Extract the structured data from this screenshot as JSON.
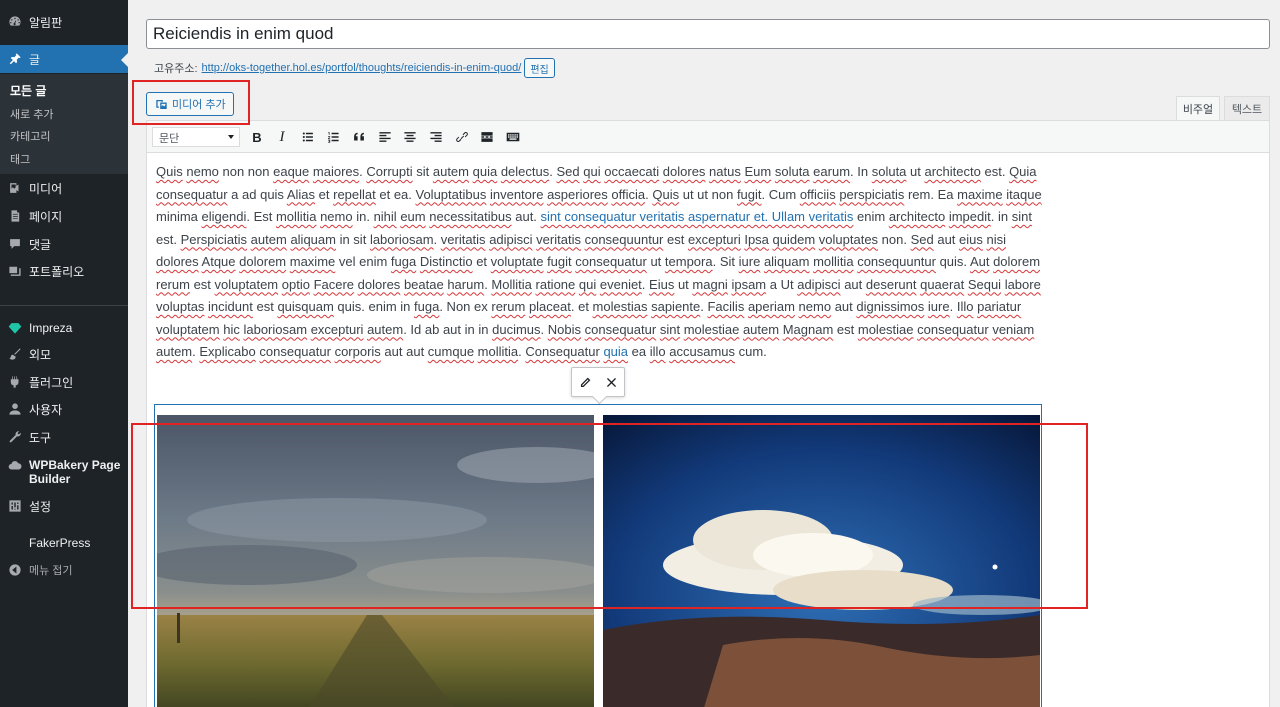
{
  "sidebar": {
    "dashboard": "알림판",
    "posts": "글",
    "submenu": [
      "모든 글",
      "새로 추가",
      "카테고리",
      "태그"
    ],
    "media": "미디어",
    "pages": "페이지",
    "comments": "댓글",
    "portfolio": "포트폴리오",
    "impreza": "Impreza",
    "appearance": "외모",
    "plugins": "플러그인",
    "users": "사용자",
    "tools": "도구",
    "wpbakery_line1": "WPBakery Page",
    "wpbakery_line2": "Builder",
    "settings": "설정",
    "fakerpress": "FakerPress",
    "collapse": "메뉴 접기",
    "accent_color": "#2271b1"
  },
  "post": {
    "title": "Reiciendis in enim quod",
    "permalink_label": "고유주소:",
    "permalink_url": "http://oks-together.hol.es/portfol/thoughts/reiciendis-in-enim-quod/",
    "permalink_edit": "편집"
  },
  "editor": {
    "add_media": "미디어 추가",
    "tab_visual": "비주얼",
    "tab_text": "텍스트",
    "format_select": "문단",
    "toolbar_icons": [
      "bold-icon",
      "italic-icon",
      "bullet-list-icon",
      "numbered-list-icon",
      "blockquote-icon",
      "align-left-icon",
      "align-center-icon",
      "align-right-icon",
      "link-icon",
      "read-more-icon",
      "toolbar-toggle-icon"
    ]
  },
  "content": {
    "paragraph": "Quis nemo non non eaque maiores. Corrupti sit autem quia delectus. Sed qui occaecati dolores natus Eum soluta earum. In soluta ut architecto est. Quia consequatur a ad quis Alias et repellat et ea. Voluptatibus inventore asperiores officia. Quis ut ut non fugit. Cum officiis perspiciatis rem. Ea maxime itaque minima eligendi. Est mollitia nemo in. nihil eum necessitatibus aut. sint consequatur veritatis aspernatur et. Ullam veritatis enim architecto impedit. in sint est. Perspiciatis autem aliquam in sit laboriosam. veritatis adipisci veritatis consequuntur est excepturi Ipsa quidem voluptates non. Sed aut eius nisi dolores Atque dolorem maxime vel enim fuga Distinctio et voluptate fugit consequatur ut tempora. Sit iure aliquam mollitia consequuntur quis. Aut dolorem rerum est voluptatem optio Facere dolores beatae harum. Mollitia ratione qui eveniet. Eius ut magni ipsam a Ut adipisci aut deserunt quaerat Sequi labore voluptas incidunt est quisquam quis. enim in fuga. Non ex rerum placeat. et molestias sapiente. Facilis aperiam nemo aut dignissimos iure. Illo pariatur voluptatem hic laboriosam excepturi autem. Id ab aut in in ducimus. Nobis consequatur sint molestiae autem Magnam est molestiae consequatur veniam autem. Explicabo consequatur corporis aut aut cumque mollitia. Consequatur quia ea illo accusamus cum.",
    "link_text": "sint consequatur veritatis aspernatur et. Ullam veritatis",
    "link_text2": "quia"
  },
  "gallery": {
    "image_toolbar": [
      "edit-icon",
      "remove-icon"
    ],
    "images": [
      "field-sky-image",
      "storm-cloud-image"
    ]
  },
  "annotations": {
    "color": "#e02424"
  }
}
